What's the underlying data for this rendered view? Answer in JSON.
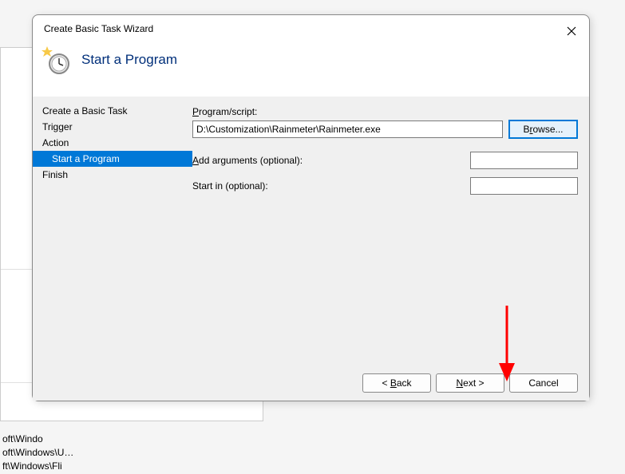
{
  "background": {
    "row1": "oft\\Windo",
    "row2": "oft\\Windows\\U…",
    "row3": "ft\\Windows\\Fli"
  },
  "dialog": {
    "title": "Create Basic Task Wizard",
    "header_title": "Start a Program"
  },
  "sidebar": {
    "items": [
      {
        "label": "Create a Basic Task",
        "sub": false,
        "selected": false
      },
      {
        "label": "Trigger",
        "sub": false,
        "selected": false
      },
      {
        "label": "Action",
        "sub": false,
        "selected": false
      },
      {
        "label": "Start a Program",
        "sub": true,
        "selected": true
      },
      {
        "label": "Finish",
        "sub": false,
        "selected": false
      }
    ]
  },
  "form": {
    "program_label_pre": "P",
    "program_label_post": "rogram/script:",
    "program_value": "D:\\Customization\\Rainmeter\\Rainmeter.exe",
    "browse_pre": "B",
    "browse_post": "rowse...",
    "args_label_pre": "A",
    "args_label_post": "dd arguments (optional):",
    "args_value": "",
    "startin_label": "Start in (optional):",
    "startin_value": ""
  },
  "footer": {
    "back_pre": "< ",
    "back_mn": "B",
    "back_post": "ack",
    "next_mn": "N",
    "next_post": "ext >",
    "cancel": "Cancel"
  }
}
